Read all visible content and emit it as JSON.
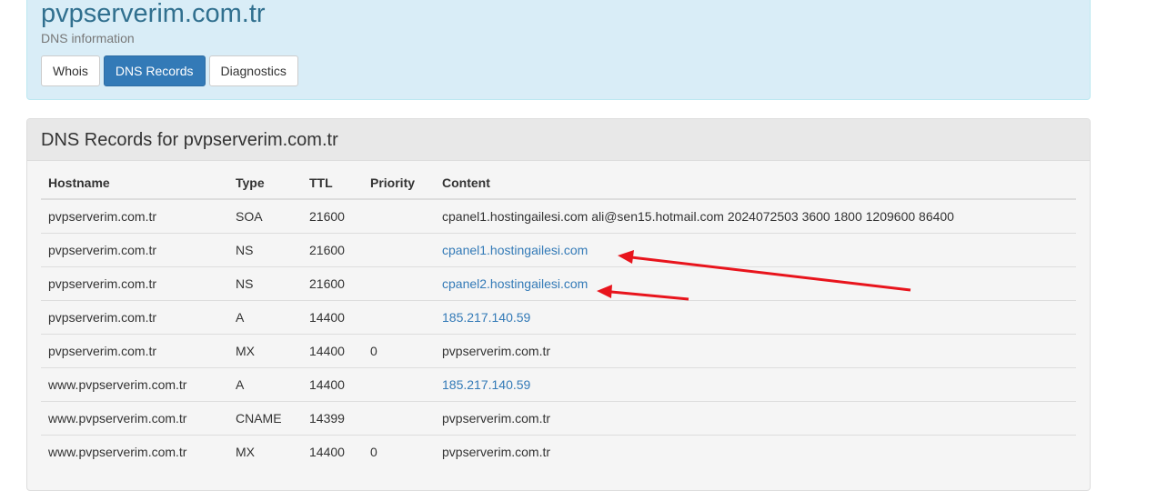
{
  "header": {
    "title": "pvpserverim.com.tr",
    "subtitle": "DNS information",
    "tabs": [
      {
        "label": "Whois",
        "active": false
      },
      {
        "label": "DNS Records",
        "active": true
      },
      {
        "label": "Diagnostics",
        "active": false
      }
    ]
  },
  "records_panel": {
    "heading": "DNS Records for pvpserverim.com.tr",
    "columns": {
      "hostname": "Hostname",
      "type": "Type",
      "ttl": "TTL",
      "priority": "Priority",
      "content": "Content"
    },
    "rows": [
      {
        "hostname": "pvpserverim.com.tr",
        "type": "SOA",
        "ttl": "21600",
        "priority": "",
        "content": "cpanel1.hostingailesi.com ali@sen15.hotmail.com 2024072503 3600 1800 1209600 86400",
        "link": false
      },
      {
        "hostname": "pvpserverim.com.tr",
        "type": "NS",
        "ttl": "21600",
        "priority": "",
        "content": "cpanel1.hostingailesi.com",
        "link": true
      },
      {
        "hostname": "pvpserverim.com.tr",
        "type": "NS",
        "ttl": "21600",
        "priority": "",
        "content": "cpanel2.hostingailesi.com",
        "link": true
      },
      {
        "hostname": "pvpserverim.com.tr",
        "type": "A",
        "ttl": "14400",
        "priority": "",
        "content": "185.217.140.59",
        "link": true
      },
      {
        "hostname": "pvpserverim.com.tr",
        "type": "MX",
        "ttl": "14400",
        "priority": "0",
        "content": "pvpserverim.com.tr",
        "link": false
      },
      {
        "hostname": "www.pvpserverim.com.tr",
        "type": "A",
        "ttl": "14400",
        "priority": "",
        "content": "185.217.140.59",
        "link": true
      },
      {
        "hostname": "www.pvpserverim.com.tr",
        "type": "CNAME",
        "ttl": "14399",
        "priority": "",
        "content": "pvpserverim.com.tr",
        "link": false
      },
      {
        "hostname": "www.pvpserverim.com.tr",
        "type": "MX",
        "ttl": "14400",
        "priority": "0",
        "content": "pvpserverim.com.tr",
        "link": false
      }
    ]
  },
  "colors": {
    "header_bg": "#d9edf7",
    "title": "#31708f",
    "active_tab": "#337ab7",
    "link": "#337ab7",
    "annotation_arrow": "#e8141c"
  }
}
